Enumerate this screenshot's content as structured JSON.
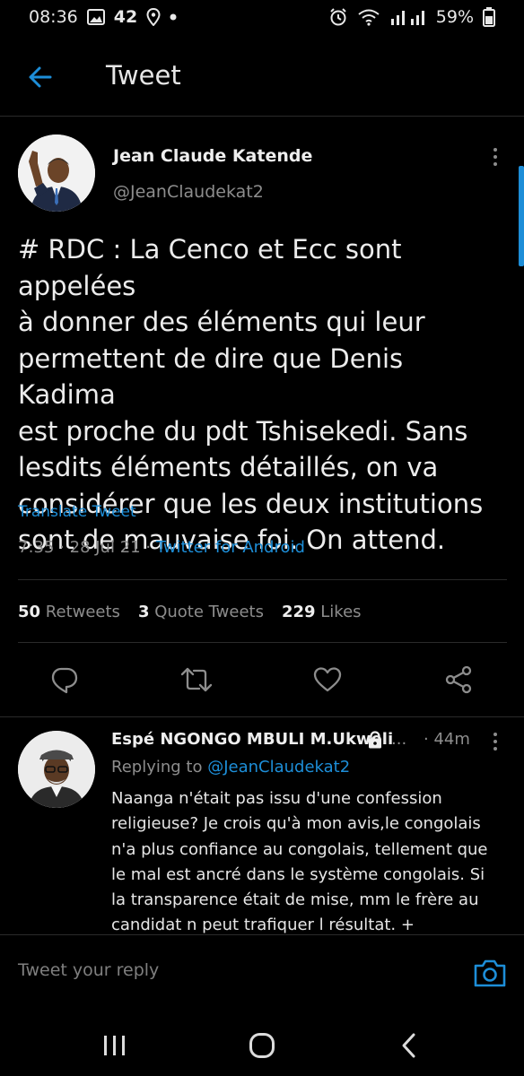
{
  "status_bar": {
    "time": "08:36",
    "notification_count": "42",
    "battery": "59%"
  },
  "header": {
    "title": "Tweet"
  },
  "tweet": {
    "author_name": "Jean Claude Katende",
    "author_handle": "@JeanClaudekat2",
    "lines": [
      "# RDC : La Cenco et Ecc sont appelées",
      "à donner des éléments qui leur",
      "permettent de dire que Denis Kadima",
      "est proche du pdt Tshisekedi. Sans",
      "lesdits éléments détaillés, on va",
      "considérer que les deux institutions",
      "sont de mauvaise foi. On attend."
    ],
    "translate_label": "Translate Tweet",
    "time": "7:35",
    "date": "28 Jul 21",
    "separator": "·",
    "client": "Twitter for Android"
  },
  "stats": {
    "retweets_count": "50",
    "retweets_label": "Retweets",
    "quotes_count": "3",
    "quotes_label": "Quote Tweets",
    "likes_count": "229",
    "likes_label": "Likes"
  },
  "actions": [
    "reply-icon",
    "retweet-icon",
    "like-icon",
    "share-icon"
  ],
  "reply": {
    "author_name": "Espé NGONGO MBULI M.Ukweli",
    "ellipsis": "...",
    "time": "· 44m",
    "replying_prefix": "Replying to",
    "replying_handle": "@JeanClaudekat2",
    "lines": [
      "Naanga n'était pas issu d'une confession",
      "religieuse? Je crois qu'à mon avis,le congolais",
      "n'a plus confiance au congolais, tellement que",
      "le mal est ancré dans le système congolais. Si",
      "la transparence était de mise, mm le frère au",
      "candidat n peut trafiquer l résultat. +"
    ]
  },
  "compose": {
    "placeholder": "Tweet your reply"
  },
  "colors": {
    "background": "#000000",
    "accent": "#1d8ed8",
    "secondary_text": "#8d8d8d"
  }
}
